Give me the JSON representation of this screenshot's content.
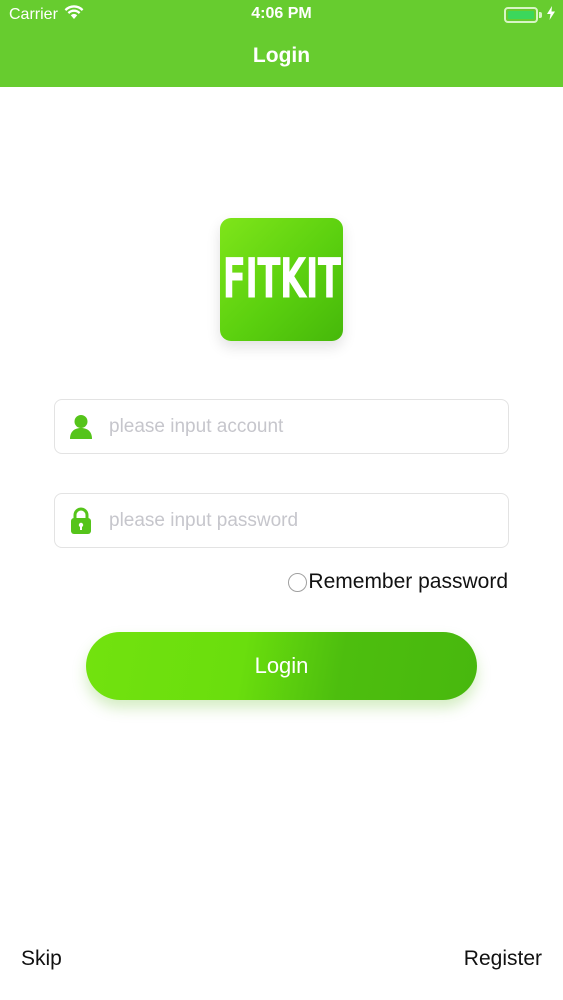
{
  "status_bar": {
    "carrier": "Carrier",
    "time": "4:06 PM",
    "wifi_icon": "wifi-icon",
    "battery_icon": "battery-icon",
    "charging_icon": "charging-bolt-icon"
  },
  "nav": {
    "title": "Login"
  },
  "logo": {
    "text": "FITKIT",
    "color": "#67cc2f"
  },
  "form": {
    "account": {
      "placeholder": "please input account",
      "value": "",
      "icon": "user-icon"
    },
    "password": {
      "placeholder": "please input password",
      "value": "",
      "icon": "lock-icon"
    },
    "remember_label": "Remember password",
    "remember_checked": false,
    "login_label": "Login"
  },
  "footer": {
    "skip_label": "Skip",
    "register_label": "Register"
  },
  "colors": {
    "brand_green": "#67cc2f",
    "button_start": "#72e20e",
    "button_end": "#48b80e",
    "placeholder": "#c6c6cc"
  }
}
